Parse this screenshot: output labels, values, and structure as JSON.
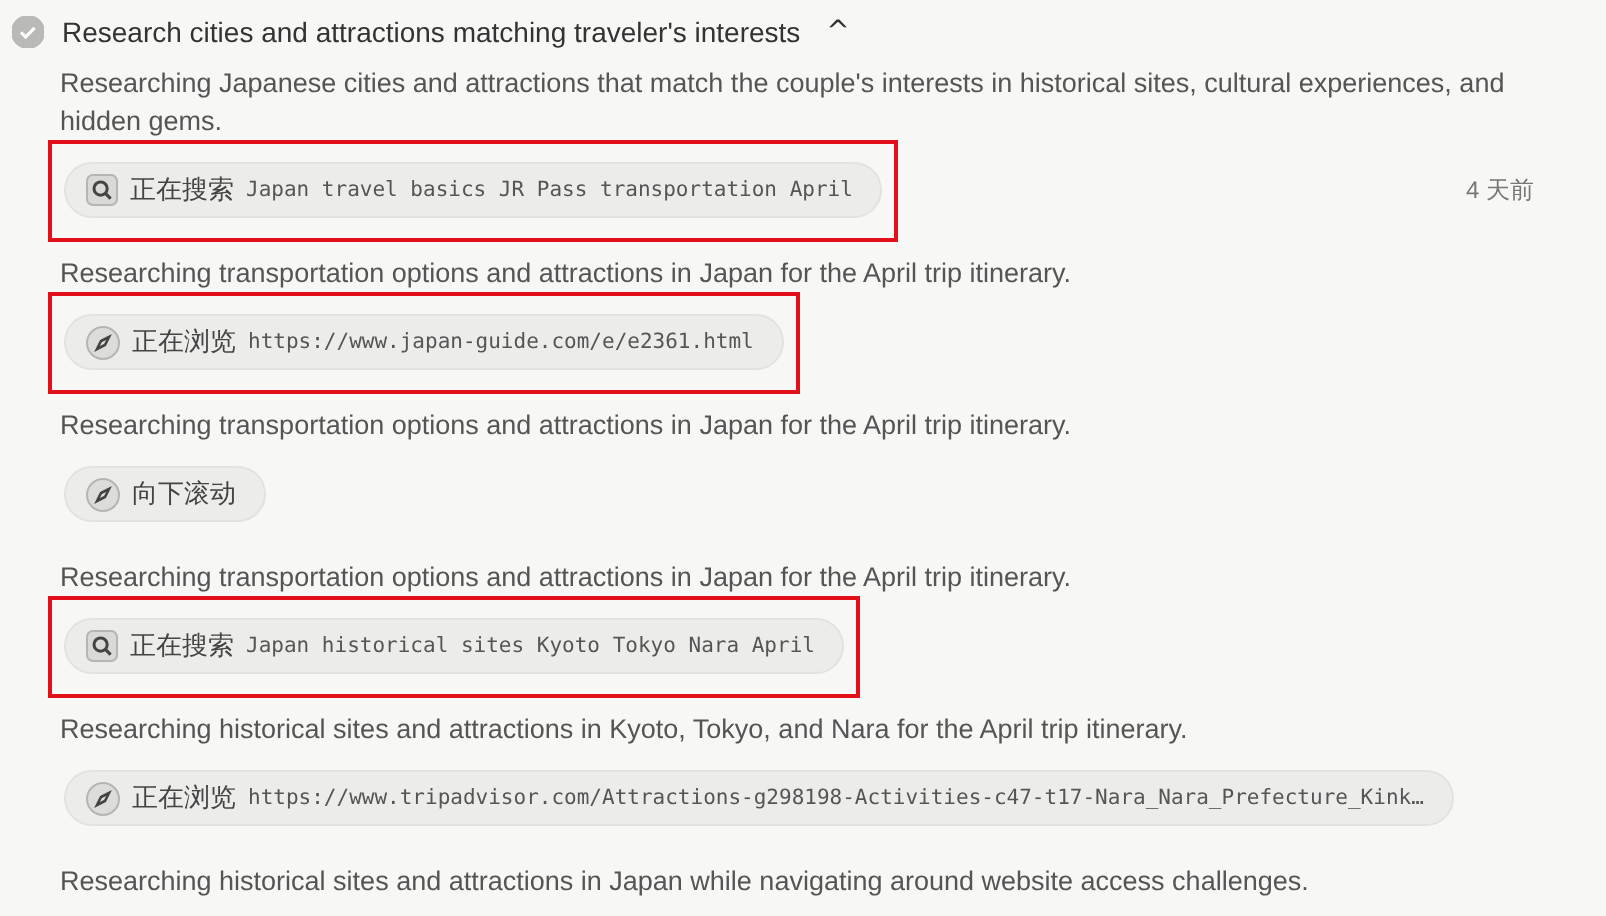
{
  "task": {
    "title": "Research cities and attractions matching traveler's interests",
    "done": true,
    "expanded": true,
    "caret": "^"
  },
  "items": [
    {
      "kind": "text",
      "text": "Researching Japanese cities and attractions that match the couple's interests in historical sites, cultural experiences, and hidden gems."
    },
    {
      "kind": "search",
      "action": "正在搜索",
      "detail": "Japan travel basics JR Pass transportation April",
      "highlighted": true,
      "time": "4 天前"
    },
    {
      "kind": "text",
      "text": "Researching transportation options and attractions in Japan for the April trip itinerary."
    },
    {
      "kind": "browse",
      "action": "正在浏览",
      "detail": "https://www.japan-guide.com/e/e2361.html",
      "highlighted": true
    },
    {
      "kind": "text",
      "text": "Researching transportation options and attractions in Japan for the April trip itinerary."
    },
    {
      "kind": "browse",
      "action": "向下滚动",
      "highlighted": false
    },
    {
      "kind": "text",
      "text": "Researching transportation options and attractions in Japan for the April trip itinerary."
    },
    {
      "kind": "search",
      "action": "正在搜索",
      "detail": "Japan historical sites Kyoto Tokyo Nara April",
      "highlighted": true
    },
    {
      "kind": "text",
      "text": "Researching historical sites and attractions in Kyoto, Tokyo, and Nara for the April trip itinerary."
    },
    {
      "kind": "browse",
      "action": "正在浏览",
      "detail": "https://www.tripadvisor.com/Attractions-g298198-Activities-c47-t17-Nara_Nara_Prefecture_Kink…",
      "highlighted": false
    },
    {
      "kind": "text",
      "text": "Researching historical sites and attractions in Japan while navigating around website access challenges."
    }
  ]
}
